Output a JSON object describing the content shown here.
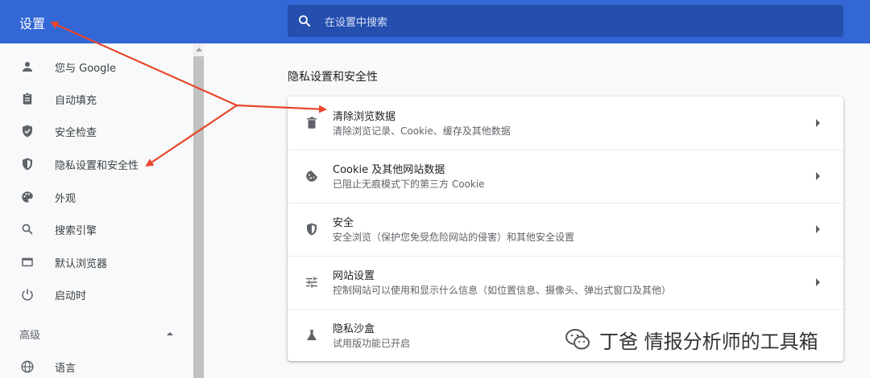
{
  "header": {
    "title": "设置",
    "search_placeholder": "在设置中搜索"
  },
  "sidebar": {
    "items": [
      {
        "label": "您与 Google",
        "icon": "person-icon"
      },
      {
        "label": "自动填充",
        "icon": "clipboard-icon"
      },
      {
        "label": "安全检查",
        "icon": "shield-check-icon"
      },
      {
        "label": "隐私设置和安全性",
        "icon": "shield-half-icon"
      },
      {
        "label": "外观",
        "icon": "palette-icon"
      },
      {
        "label": "搜索引擎",
        "icon": "search-icon"
      },
      {
        "label": "默认浏览器",
        "icon": "browser-icon"
      },
      {
        "label": "启动时",
        "icon": "power-icon"
      }
    ],
    "advanced_label": "高级",
    "advanced_items": [
      {
        "label": "语言",
        "icon": "globe-icon"
      }
    ]
  },
  "main": {
    "section_title": "隐私设置和安全性",
    "rows": [
      {
        "title": "清除浏览数据",
        "subtitle": "清除浏览记录、Cookie、缓存及其他数据",
        "icon": "trash-icon",
        "has_arrow": true
      },
      {
        "title": "Cookie 及其他网站数据",
        "subtitle": "已阻止无痕模式下的第三方 Cookie",
        "icon": "cookie-icon",
        "has_arrow": true
      },
      {
        "title": "安全",
        "subtitle": "安全浏览（保护您免受危险网站的侵害）和其他安全设置",
        "icon": "shield-half-icon",
        "has_arrow": true
      },
      {
        "title": "网站设置",
        "subtitle": "控制网站可以使用和显示什么信息（如位置信息、摄像头、弹出式窗口及其他）",
        "icon": "tune-icon",
        "has_arrow": true
      },
      {
        "title": "隐私沙盒",
        "subtitle": "试用版功能已开启",
        "icon": "flask-icon",
        "has_arrow": false
      }
    ]
  },
  "watermark": {
    "text": "丁爸 情报分析师的工具箱"
  },
  "colors": {
    "header_bg": "#3367d6",
    "search_bg": "#254fae",
    "annotation_arrow": "#e8472b",
    "icon_gray": "#5f6368"
  }
}
